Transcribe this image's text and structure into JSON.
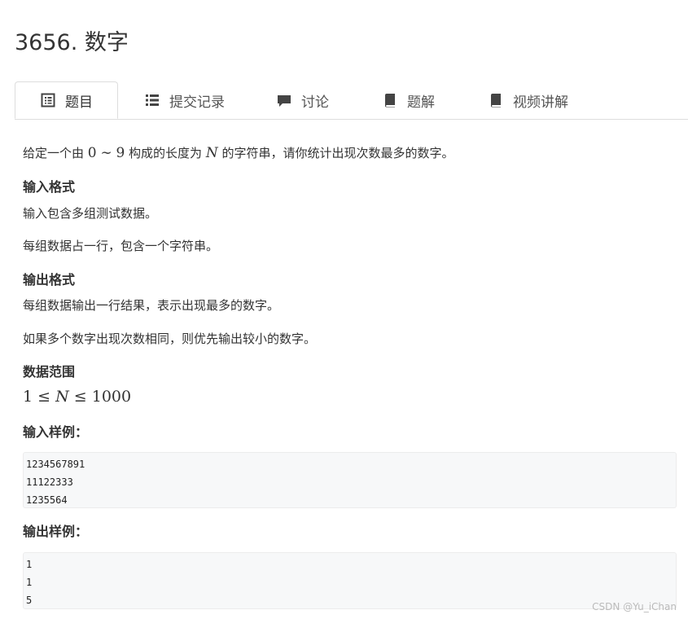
{
  "problem": {
    "title": "3656. 数字"
  },
  "tabs": [
    {
      "label": "题目",
      "icon": "list-alt-icon",
      "active": true
    },
    {
      "label": "提交记录",
      "icon": "list-icon",
      "active": false
    },
    {
      "label": "讨论",
      "icon": "comment-icon",
      "active": false
    },
    {
      "label": "题解",
      "icon": "book-icon",
      "active": false
    },
    {
      "label": "视频讲解",
      "icon": "book-icon",
      "active": false
    }
  ],
  "description": {
    "text_before": "给定一个由",
    "range_start": "0",
    "tilde": "∼",
    "range_end": "9",
    "text_mid": "构成的长度为",
    "var_n": "N",
    "text_after": "的字符串，请你统计出现次数最多的数字。"
  },
  "input_format": {
    "heading": "输入格式",
    "lines": [
      "输入包含多组测试数据。",
      "每组数据占一行，包含一个字符串。"
    ]
  },
  "output_format": {
    "heading": "输出格式",
    "lines": [
      "每组数据输出一行结果，表示出现最多的数字。",
      "如果多个数字出现次数相同，则优先输出较小的数字。"
    ]
  },
  "data_range": {
    "heading": "数据范围",
    "lower": "1",
    "leq1": "≤",
    "var": "N",
    "leq2": "≤",
    "upper": "1000"
  },
  "sample_input": {
    "heading": "输入样例：",
    "lines": [
      "1234567891",
      "11122333",
      "1235564"
    ]
  },
  "sample_output": {
    "heading": "输出样例：",
    "lines": [
      "1",
      "1",
      "5"
    ]
  },
  "watermark": "CSDN @Yu_iChan"
}
